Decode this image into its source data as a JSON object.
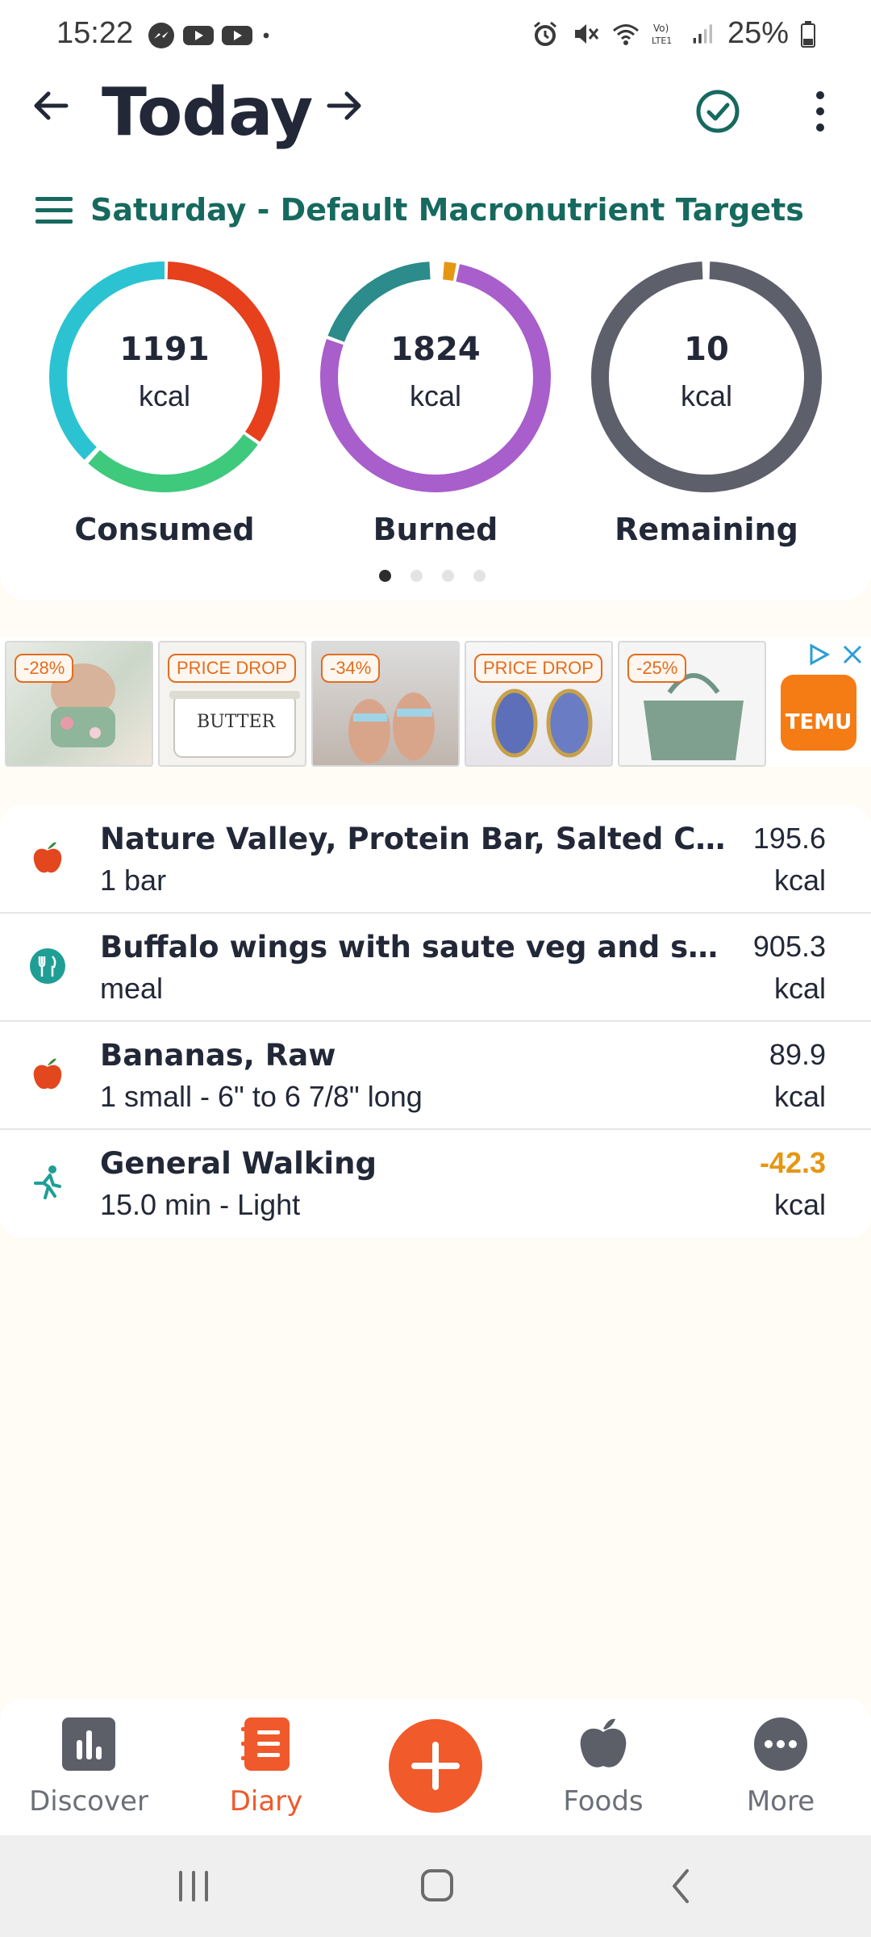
{
  "status_bar": {
    "time": "15:22",
    "battery": "25%",
    "left_icons": [
      "messenger-icon",
      "youtube-icon",
      "youtube-icon",
      "dot-icon"
    ],
    "right_icons": [
      "alarm-icon",
      "mute-icon",
      "wifi-icon",
      "volte-icon",
      "signal-icon",
      "battery-icon"
    ]
  },
  "header": {
    "title": "Today",
    "subtitle": "Saturday - Default Macronutrient Targets"
  },
  "summary": [
    {
      "value": "1191",
      "unit": "kcal",
      "label": "Consumed"
    },
    {
      "value": "1824",
      "unit": "kcal",
      "label": "Burned"
    },
    {
      "value": "10",
      "unit": "kcal",
      "label": "Remaining"
    }
  ],
  "pager": {
    "count": 4,
    "active": 0
  },
  "ad": {
    "badges": [
      "-28%",
      "PRICE DROP",
      "-34%",
      "PRICE DROP",
      "-25%"
    ],
    "tile_2_text": "BUTTER",
    "brand": "TEMU"
  },
  "entries": [
    {
      "icon": "apple-icon",
      "name": "Nature Valley, Protein Bar, Salted Caramel Nut",
      "detail": "1 bar",
      "value": "195.6",
      "unit": "kcal"
    },
    {
      "icon": "meal-icon",
      "name": "Buffalo wings with saute veg and sweet potato",
      "detail": "meal",
      "value": "905.3",
      "unit": "kcal"
    },
    {
      "icon": "apple-icon",
      "name": "Bananas, Raw",
      "detail": "1 small - 6\" to 6 7/8\" long",
      "value": "89.9",
      "unit": "kcal"
    },
    {
      "icon": "walking-icon",
      "name": "General Walking",
      "detail": "15.0 min - Light",
      "value": "-42.3",
      "unit": "kcal"
    }
  ],
  "nav": {
    "discover": "Discover",
    "diary": "Diary",
    "foods": "Foods",
    "more": "More"
  },
  "colors": {
    "accent": "#f15a2b",
    "teal": "#16695e",
    "exercise": "#e59714"
  }
}
